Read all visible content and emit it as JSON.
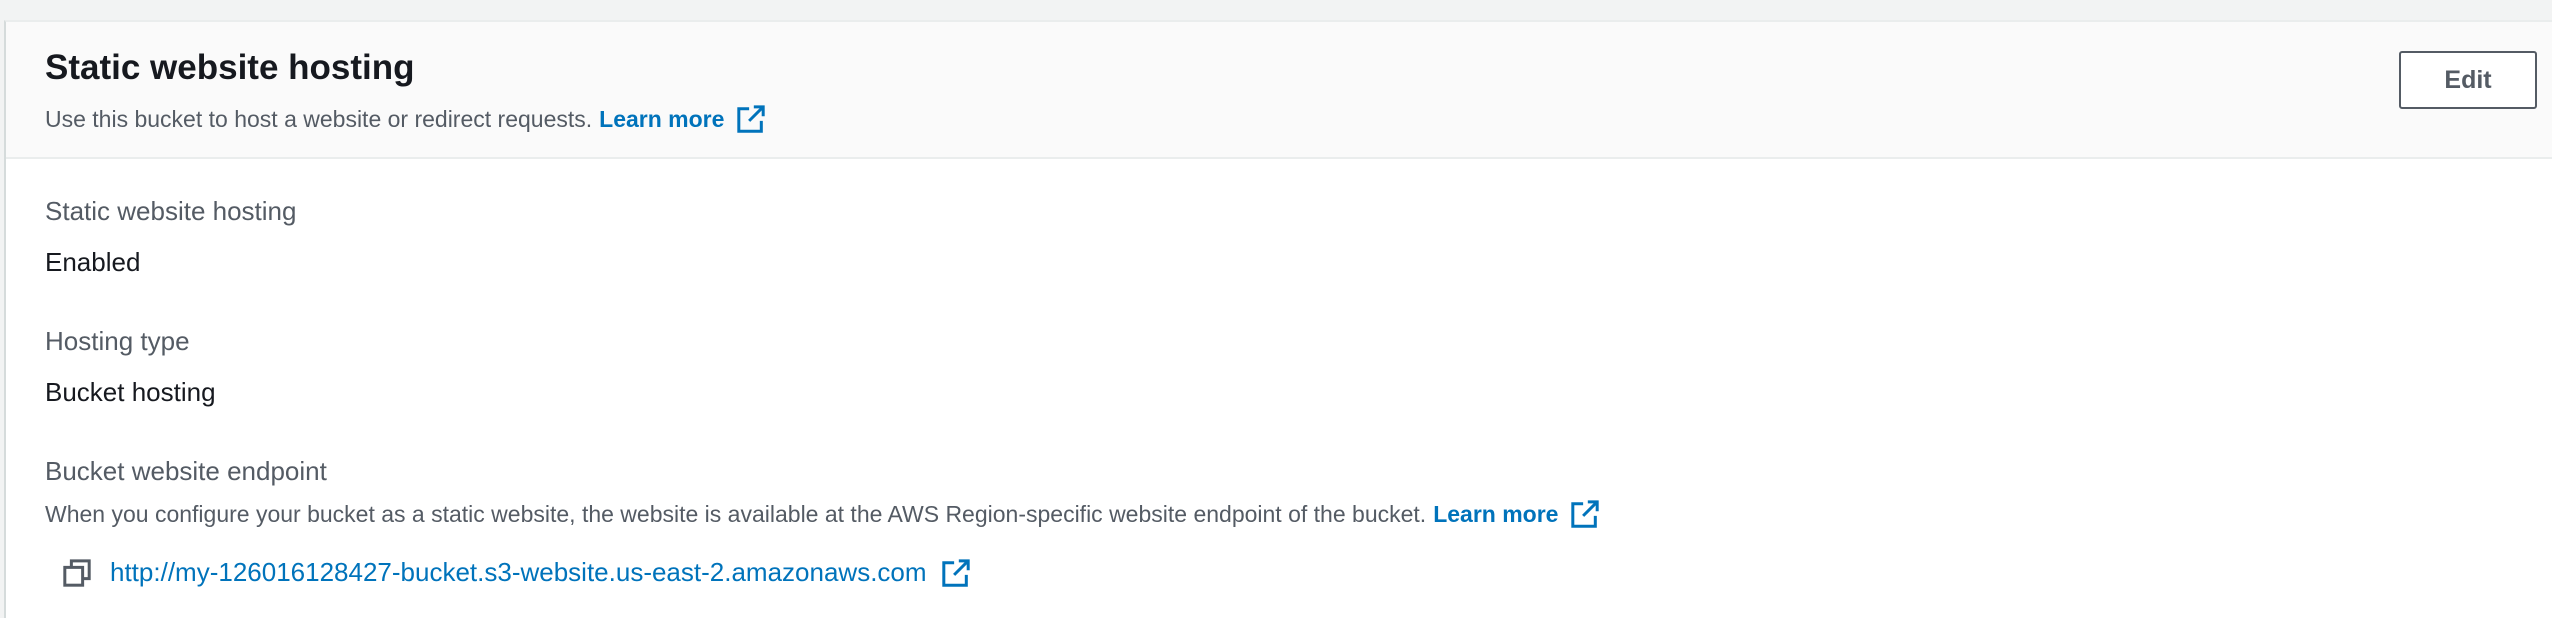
{
  "header": {
    "title": "Static website hosting",
    "description": "Use this bucket to host a website or redirect requests.",
    "learn_more": "Learn more",
    "edit_label": "Edit"
  },
  "fields": {
    "hosting_label": "Static website hosting",
    "hosting_value": "Enabled",
    "type_label": "Hosting type",
    "type_value": "Bucket hosting",
    "endpoint_label": "Bucket website endpoint",
    "endpoint_desc": "When you configure your bucket as a static website, the website is available at the AWS Region-specific website endpoint of the bucket.",
    "endpoint_learn_more": "Learn more",
    "endpoint_url": "http://my-126016128427-bucket.s3-website.us-east-2.amazonaws.com"
  },
  "icons": {
    "external_link": "external-link-icon",
    "copy": "copy-icon"
  },
  "colors": {
    "link": "#0073bb",
    "label": "#545b64",
    "text": "#16191f",
    "header_bg": "#fafafa"
  }
}
